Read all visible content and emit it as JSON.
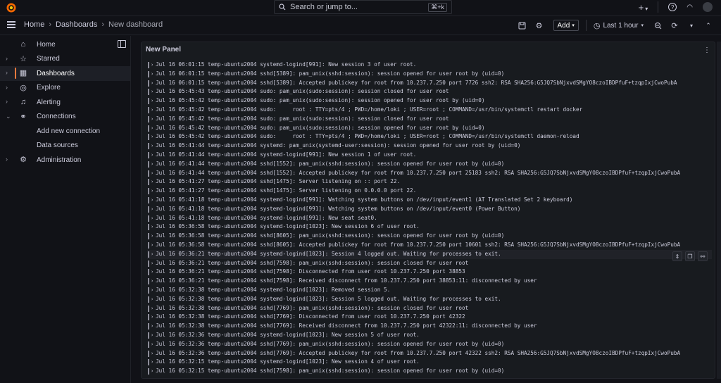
{
  "topbar": {
    "search_placeholder": "Search or jump to...",
    "search_shortcut": "⌘+k",
    "add_symbol": "+"
  },
  "breadcrumb": {
    "home": "Home",
    "dashboards": "Dashboards",
    "current": "New dashboard"
  },
  "toolbar": {
    "add_label": "Add",
    "time_range": "Last 1 hour"
  },
  "sidebar": {
    "items": [
      {
        "label": "Home",
        "icon": "home-icon"
      },
      {
        "label": "Starred",
        "icon": "star-icon"
      },
      {
        "label": "Dashboards",
        "icon": "dashboards-icon"
      },
      {
        "label": "Explore",
        "icon": "compass-icon"
      },
      {
        "label": "Alerting",
        "icon": "bell-icon"
      },
      {
        "label": "Connections",
        "icon": "link-icon"
      },
      {
        "label": "Add new connection"
      },
      {
        "label": "Data sources"
      },
      {
        "label": "Administration",
        "icon": "gear-icon"
      }
    ]
  },
  "panel": {
    "title": "New Panel",
    "logs": [
      "Jul 16 06:01:15 temp-ubuntu2004 systemd-logind[991]: New session 3 of user root.",
      "Jul 16 06:01:15 temp-ubuntu2004 sshd[5389]: pam_unix(sshd:session): session opened for user root by (uid=0)",
      "Jul 16 06:01:15 temp-ubuntu2004 sshd[5389]: Accepted publickey for root from 10.237.7.250 port 7726 ssh2: RSA SHA256:G5JQ7SbNjxvdSMgYO8czoIBDPfuF+tzqpIxjCwoPubA",
      "Jul 16 05:45:43 temp-ubuntu2004 sudo: pam_unix(sudo:session): session closed for user root",
      "Jul 16 05:45:42 temp-ubuntu2004 sudo: pam_unix(sudo:session): session opened for user root by (uid=0)",
      "Jul 16 05:45:42 temp-ubuntu2004 sudo:     root : TTY=pts/4 ; PWD=/home/loki ; USER=root ; COMMAND=/usr/bin/systemctl restart docker",
      "Jul 16 05:45:42 temp-ubuntu2004 sudo: pam_unix(sudo:session): session closed for user root",
      "Jul 16 05:45:42 temp-ubuntu2004 sudo: pam_unix(sudo:session): session opened for user root by (uid=0)",
      "Jul 16 05:45:42 temp-ubuntu2004 sudo:     root : TTY=pts/4 ; PWD=/home/loki ; USER=root ; COMMAND=/usr/bin/systemctl daemon-reload",
      "Jul 16 05:41:44 temp-ubuntu2004 systemd: pam_unix(systemd-user:session): session opened for user root by (uid=0)",
      "Jul 16 05:41:44 temp-ubuntu2004 systemd-logind[991]: New session 1 of user root.",
      "Jul 16 05:41:44 temp-ubuntu2004 sshd[1552]: pam_unix(sshd:session): session opened for user root by (uid=0)",
      "Jul 16 05:41:44 temp-ubuntu2004 sshd[1552]: Accepted publickey for root from 10.237.7.250 port 25183 ssh2: RSA SHA256:G5JQ7SbNjxvdSMgYO8czoIBDPfuF+tzqpIxjCwoPubA",
      "Jul 16 05:41:27 temp-ubuntu2004 sshd[1475]: Server listening on :: port 22.",
      "Jul 16 05:41:27 temp-ubuntu2004 sshd[1475]: Server listening on 0.0.0.0 port 22.",
      "Jul 16 05:41:18 temp-ubuntu2004 systemd-logind[991]: Watching system buttons on /dev/input/event1 (AT Translated Set 2 keyboard)",
      "Jul 16 05:41:18 temp-ubuntu2004 systemd-logind[991]: Watching system buttons on /dev/input/event0 (Power Button)",
      "Jul 16 05:41:18 temp-ubuntu2004 systemd-logind[991]: New seat seat0.",
      "Jul 16 05:36:58 temp-ubuntu2004 systemd-logind[1023]: New session 6 of user root.",
      "Jul 16 05:36:58 temp-ubuntu2004 sshd[8605]: pam_unix(sshd:session): session opened for user root by (uid=0)",
      "Jul 16 05:36:58 temp-ubuntu2004 sshd[8605]: Accepted publickey for root from 10.237.7.250 port 10601 ssh2: RSA SHA256:G5JQ7SbNjxvdSMgYO8czoIBDPfuF+tzqpIxjCwoPubA",
      "Jul 16 05:36:21 temp-ubuntu2004 systemd-logind[1023]: Session 4 logged out. Waiting for processes to exit.",
      "Jul 16 05:36:21 temp-ubuntu2004 sshd[7598]: pam_unix(sshd:session): session closed for user root",
      "Jul 16 05:36:21 temp-ubuntu2004 sshd[7598]: Disconnected from user root 10.237.7.250 port 38853",
      "Jul 16 05:36:21 temp-ubuntu2004 sshd[7598]: Received disconnect from 10.237.7.250 port 38853:11: disconnected by user",
      "Jul 16 05:32:38 temp-ubuntu2004 systemd-logind[1023]: Removed session 5.",
      "Jul 16 05:32:38 temp-ubuntu2004 systemd-logind[1023]: Session 5 logged out. Waiting for processes to exit.",
      "Jul 16 05:32:38 temp-ubuntu2004 sshd[7769]: pam_unix(sshd:session): session closed for user root",
      "Jul 16 05:32:38 temp-ubuntu2004 sshd[7769]: Disconnected from user root 10.237.7.250 port 42322",
      "Jul 16 05:32:38 temp-ubuntu2004 sshd[7769]: Received disconnect from 10.237.7.250 port 42322:11: disconnected by user",
      "Jul 16 05:32:36 temp-ubuntu2004 systemd-logind[1023]: New session 5 of user root.",
      "Jul 16 05:32:36 temp-ubuntu2004 sshd[7769]: pam_unix(sshd:session): session opened for user root by (uid=0)",
      "Jul 16 05:32:36 temp-ubuntu2004 sshd[7769]: Accepted publickey for root from 10.237.7.250 port 42322 ssh2: RSA SHA256:G5JQ7SbNjxvdSMgYO8czoIBDPfuF+tzqpIxjCwoPubA",
      "Jul 16 05:32:15 temp-ubuntu2004 systemd-logind[1023]: New session 4 of user root.",
      "Jul 16 05:32:15 temp-ubuntu2004 sshd[7598]: pam_unix(sshd:session): session opened for user root by (uid=0)"
    ]
  },
  "colors": {
    "accent": "#ff7a3d",
    "background": "#111217",
    "panel": "#181b1f"
  }
}
